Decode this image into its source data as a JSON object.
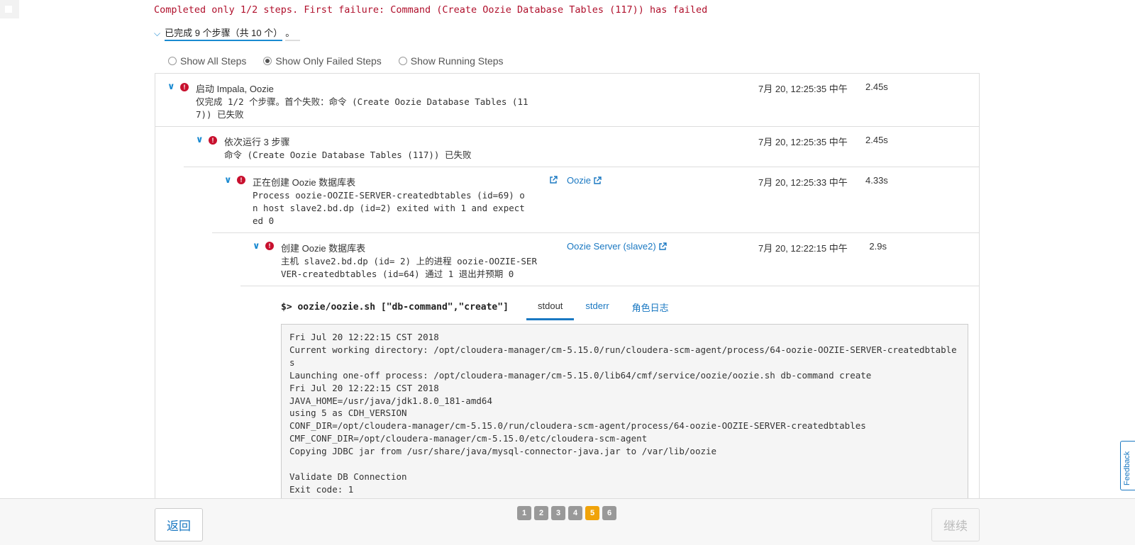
{
  "header": {
    "failure_message": "Completed only 1/2 steps. First failure: Command (Create Oozie Database Tables (117)) has failed",
    "summary_main": "已完成 9 个步骤（共 10 个）",
    "summary_suffix": "。"
  },
  "filters": [
    {
      "label": "Show All Steps",
      "selected": false
    },
    {
      "label": "Show Only Failed Steps",
      "selected": true
    },
    {
      "label": "Show Running Steps",
      "selected": false
    }
  ],
  "steps": [
    {
      "title": "启动 Impala, Oozie",
      "description": "仅完成 1/2 个步骤。首个失败：命令 (Create Oozie Database Tables (11\n7)) 已失败",
      "timestamp": "7月 20, 12:25:35 中午",
      "duration": "2.45s"
    },
    {
      "title": "依次运行 3 步骤",
      "description": "命令 (Create Oozie Database Tables (117)) 已失败",
      "timestamp": "7月 20, 12:25:35 中午",
      "duration": "2.45s"
    },
    {
      "title": "正在创建 Oozie 数据库表",
      "description": "Process oozie-OOZIE-SERVER-createdbtables (id=69) o\nn host slave2.bd.dp (id=2) exited with 1 and expect\ned 0",
      "link": "Oozie",
      "timestamp": "7月 20, 12:25:33 中午",
      "duration": "4.33s"
    },
    {
      "title": "创建 Oozie 数据库表",
      "description": "主机 slave2.bd.dp (id= 2) 上的进程 oozie-OOZIE-SER\nVER-createdbtables (id=64) 通过 1 退出并预期 0",
      "link": "Oozie Server (slave2)",
      "timestamp": "7月 20, 12:22:15 中午",
      "duration": "2.9s"
    }
  ],
  "command": {
    "prompt": "$>",
    "text": "oozie/oozie.sh [\"db-command\",\"create\"]"
  },
  "log_tabs": [
    {
      "label": "stdout",
      "active": true
    },
    {
      "label": "stderr",
      "active": false
    },
    {
      "label": "角色日志",
      "active": false
    }
  ],
  "log_lines": [
    "Fri Jul 20 12:22:15 CST 2018",
    "Current working directory: /opt/cloudera-manager/cm-5.15.0/run/cloudera-scm-agent/process/64-oozie-OOZIE-SERVER-createdbtables",
    "Launching one-off process: /opt/cloudera-manager/cm-5.15.0/lib64/cmf/service/oozie/oozie.sh db-command create",
    "Fri Jul 20 12:22:15 CST 2018",
    "JAVA_HOME=/usr/java/jdk1.8.0_181-amd64",
    "using 5 as CDH_VERSION",
    "CONF_DIR=/opt/cloudera-manager/cm-5.15.0/run/cloudera-scm-agent/process/64-oozie-OOZIE-SERVER-createdbtables",
    "CMF_CONF_DIR=/opt/cloudera-manager/cm-5.15.0/etc/cloudera-scm-agent",
    "Copying JDBC jar from /usr/share/java/mysql-connector-java.jar to /var/lib/oozie",
    "",
    "Validate DB Connection",
    "Exit code: 1"
  ],
  "footer": {
    "back_label": "返回",
    "next_label": "继续",
    "pages": [
      "1",
      "2",
      "3",
      "4",
      "5",
      "6"
    ],
    "current_page": "5"
  },
  "feedback_label": "Feedback",
  "colors": {
    "error": "#c8102e",
    "link": "#1a78c2",
    "active_page": "#f0a30a"
  }
}
